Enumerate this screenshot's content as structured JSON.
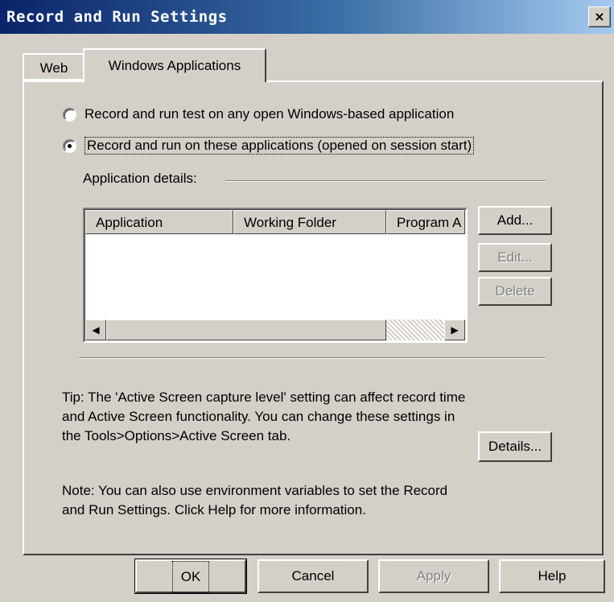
{
  "window": {
    "title": "Record and Run Settings",
    "close_label": "×"
  },
  "tabs": [
    {
      "label": "Web",
      "active": false
    },
    {
      "label": "Windows Applications",
      "active": true
    }
  ],
  "options": [
    {
      "label": "Record and run test on any open Windows-based application",
      "checked": false
    },
    {
      "label": "Record and run on these applications (opened on session start)",
      "checked": true
    }
  ],
  "app_details": {
    "label": "Application details:",
    "columns": [
      "Application",
      "Working Folder",
      "Program A"
    ],
    "rows": [],
    "scroll_left_icon": "◀",
    "scroll_right_icon": "▶"
  },
  "side_buttons": {
    "add": "Add...",
    "edit": "Edit...",
    "delete": "Delete"
  },
  "tip": {
    "line1": "Tip: The 'Active Screen capture level' setting can affect record time",
    "line2": "and Active Screen functionality.  You can change these settings in",
    "line3": "the Tools>Options>Active Screen tab.",
    "details_button": "Details..."
  },
  "note": {
    "line1": "Note: You can also use environment variables to set the Record",
    "line2": "and Run Settings.  Click Help for more information."
  },
  "footer": {
    "ok": "OK",
    "cancel": "Cancel",
    "apply": "Apply",
    "help": "Help"
  },
  "colors": {
    "title_start": "#0a246a",
    "title_end": "#a6caf0",
    "face": "#d4d0c8"
  }
}
